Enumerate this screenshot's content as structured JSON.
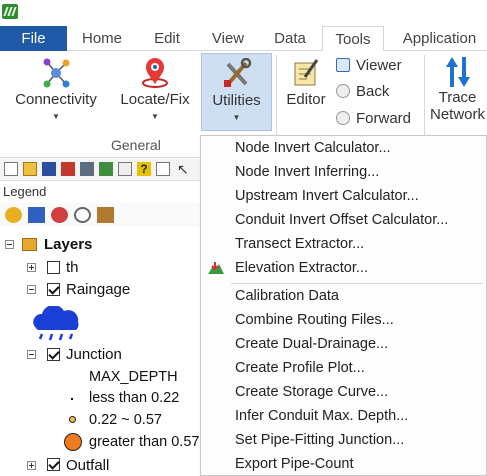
{
  "tabs": {
    "file": "File",
    "home": "Home",
    "edit": "Edit",
    "view": "View",
    "data": "Data",
    "tools": "Tools",
    "application": "Application"
  },
  "ribbon": {
    "connectivity": "Connectivity",
    "locate_fix": "Locate/Fix",
    "utilities": "Utilities",
    "group_general": "General",
    "editor": "Editor",
    "viewer": "Viewer",
    "back": "Back",
    "forward": "Forward",
    "trace_line1": "Trace",
    "trace_line2": "Network"
  },
  "legend": {
    "title": "Legend",
    "layers": "Layers",
    "th": "th",
    "raingage": "Raingage",
    "junction": "Junction",
    "max_depth": "MAX_DEPTH",
    "less_than": "less than 0.22",
    "range": "0.22 ~ 0.57",
    "greater_than": "greater than 0.57",
    "outfall": "Outfall"
  },
  "menu": {
    "items": [
      "Node Invert Calculator...",
      "Node Invert Inferring...",
      "Upstream Invert Calculator...",
      "Conduit Invert Offset Calculator...",
      "Transect Extractor...",
      "Elevation Extractor...",
      "Calibration Data",
      "Combine Routing Files...",
      "Create Dual-Drainage...",
      "Create Profile Plot...",
      "Create Storage Curve...",
      "Infer Conduit Max. Depth...",
      "Set Pipe-Fitting Junction...",
      "Export Pipe-Count"
    ]
  },
  "colors": {
    "file_tab": "#1e5aa8",
    "pressed_button": "#cfdff2",
    "raingage_symbol": "#1a3fd6",
    "junction_large": "#f07a1e"
  }
}
